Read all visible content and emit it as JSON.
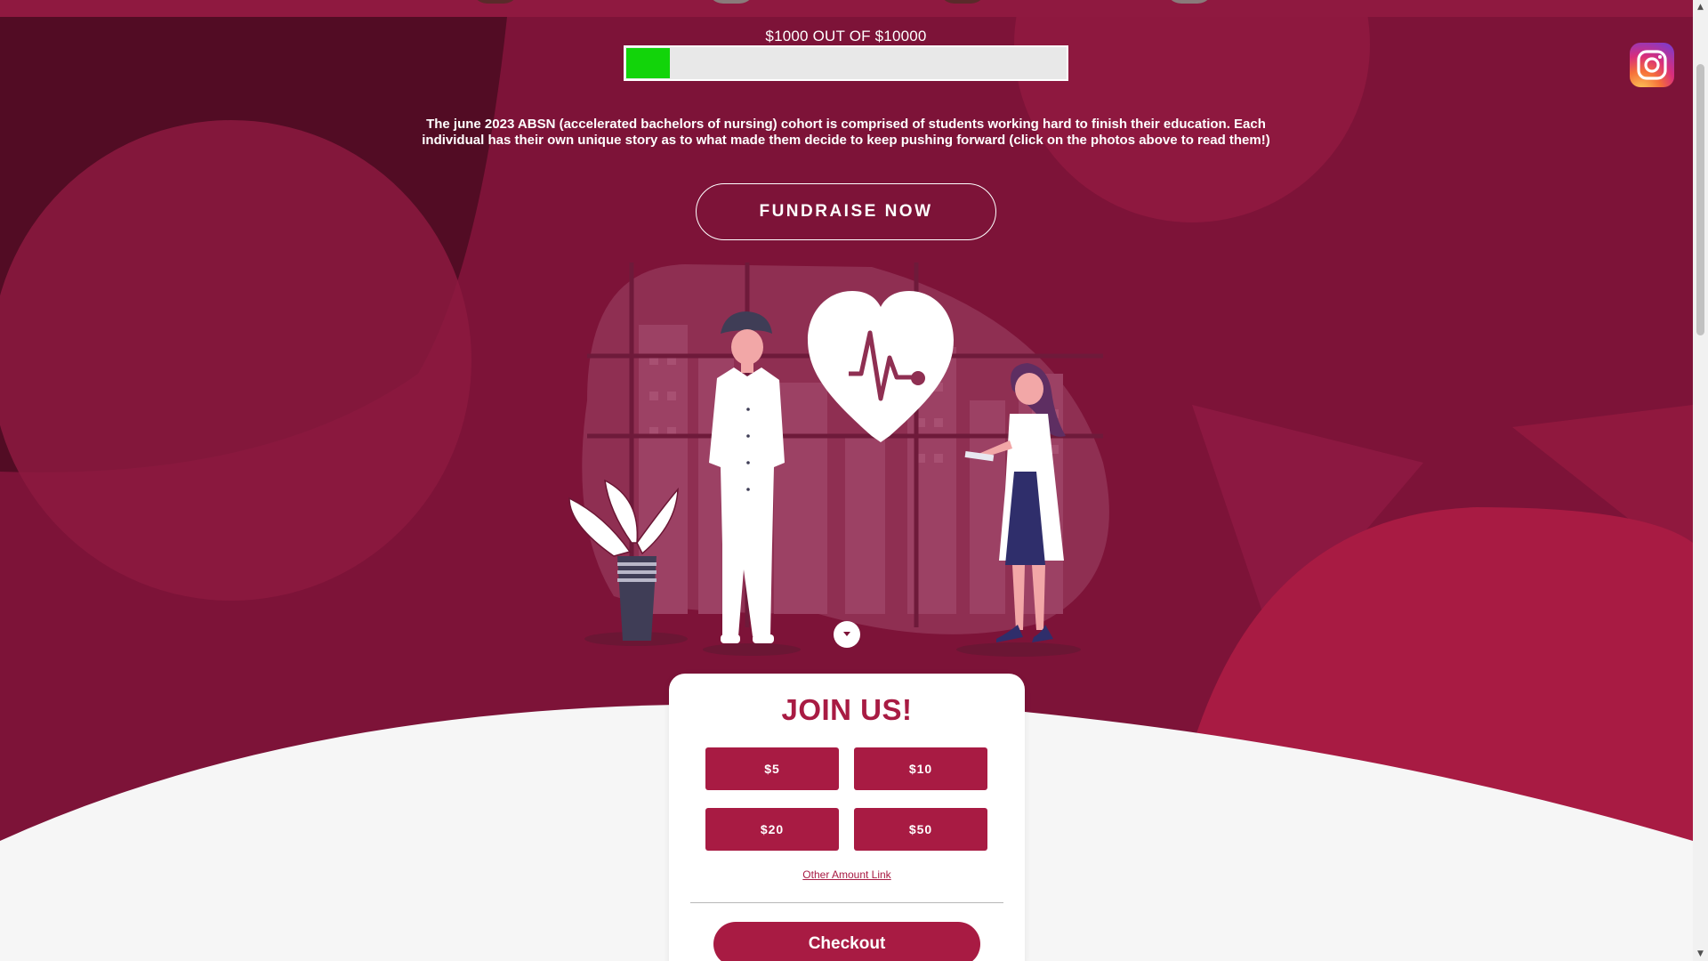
{
  "progress": {
    "label": "$1000 OUT OF $10000",
    "raised": 1000,
    "goal": 10000,
    "fraction": 0.1,
    "fill_color": "#12d40a"
  },
  "description": "The june 2023 ABSN (accelerated bachelors of nursing) cohort is comprised of students working hard to finish their education. Each individual has their own unique story as to what made them decide to keep pushing forward (click on the photos above to read them!)",
  "fundraise_button": "FUNDRAISE NOW",
  "social": {
    "icon": "instagram-icon"
  },
  "donation_card": {
    "title": "JOIN US!",
    "amounts": [
      "$5",
      "$10",
      "$20",
      "$50"
    ],
    "other_amount_link": "Other Amount Link",
    "checkout_label": "Checkout"
  },
  "colors": {
    "brand": "#a81b43",
    "background": "#7d1338",
    "footer_background": "#f6f6f6"
  }
}
